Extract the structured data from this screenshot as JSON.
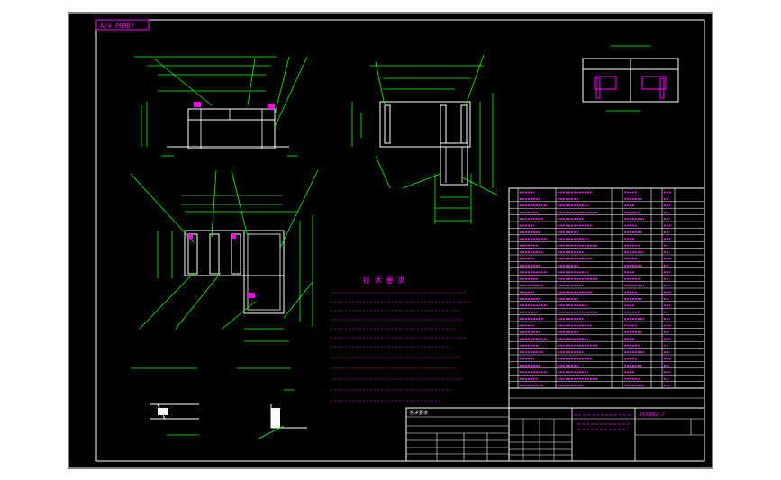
{
  "colors": {
    "background": "#000000",
    "frame": "#ffffff",
    "geometry": "#ffffff",
    "dimension": "#00ff00",
    "annotation": "#ff00ff",
    "table_lines": "#ffffff"
  },
  "drawing": {
    "corner_tag": "A/4 P80B7",
    "drawing_number": "JXX082-7",
    "technical_requirements_title": "技 术 要 求"
  },
  "title_block": {
    "notes_header": "技术要求"
  },
  "icons": [
    "cad-title-tag"
  ]
}
